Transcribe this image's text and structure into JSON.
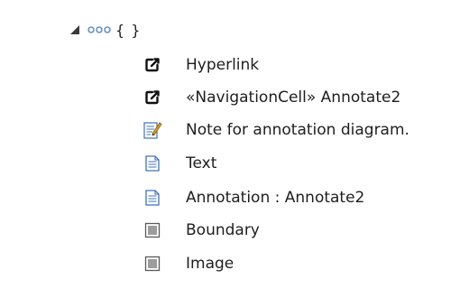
{
  "tree": {
    "root": {
      "label": "{ }",
      "expander_icon": "expanded-triangle-icon",
      "type_icon": "three-dots-icon"
    },
    "items": [
      {
        "label": "Hyperlink",
        "icon": "hyperlink-icon"
      },
      {
        "label": "«NavigationCell» Annotate2",
        "icon": "hyperlink-icon"
      },
      {
        "label": "Note for annotation diagram.",
        "icon": "note-icon"
      },
      {
        "label": "Text",
        "icon": "text-document-icon"
      },
      {
        "label": "Annotation : Annotate2",
        "icon": "text-document-icon"
      },
      {
        "label": "Boundary",
        "icon": "boundary-square-icon"
      },
      {
        "label": "Image",
        "icon": "image-square-icon"
      }
    ]
  },
  "colors": {
    "expander": "#3a3a3a",
    "dots": "#4a7fc1",
    "doc_border": "#3f73b8",
    "square_fill": "#9c9c9c",
    "square_border": "#5a5a5a",
    "note_pen": "#c58a00"
  }
}
